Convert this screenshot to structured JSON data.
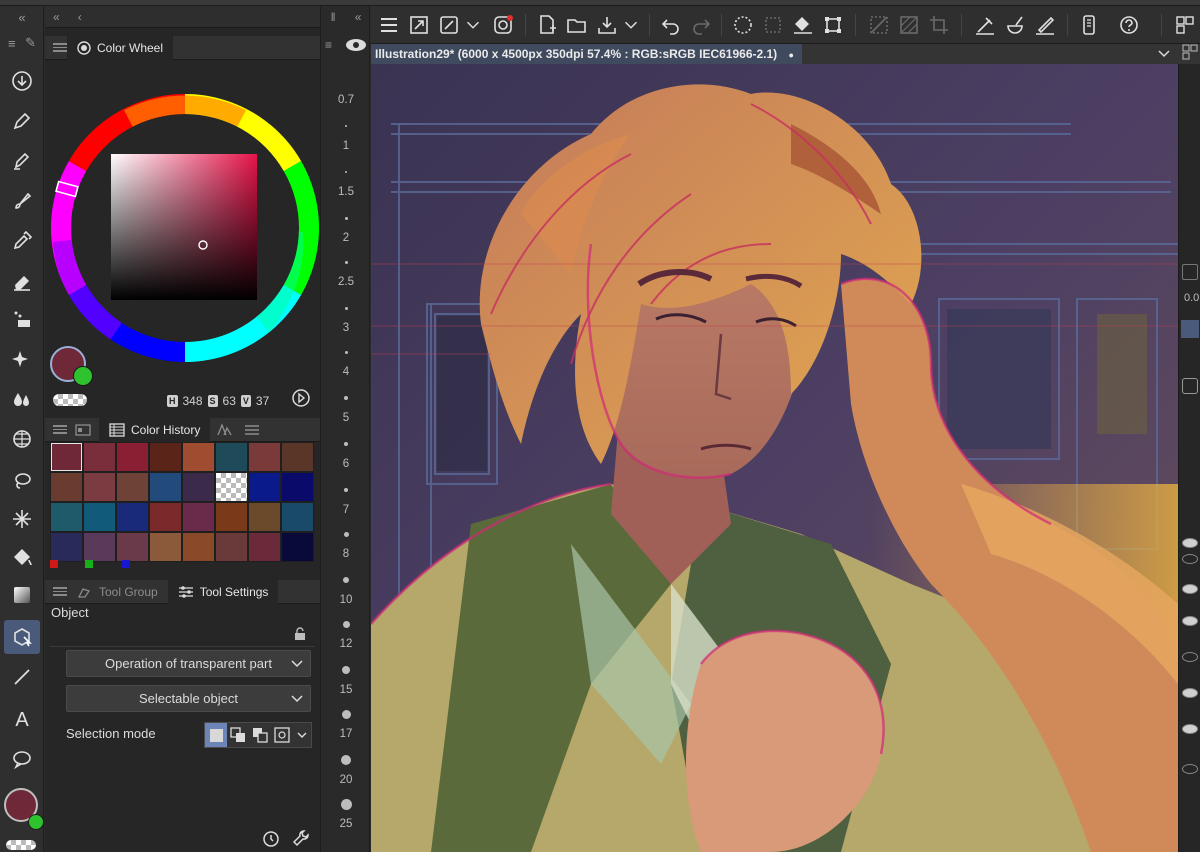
{
  "document": {
    "title": "Illustration29* (6000 x 4500px 350dpi 57.4% : RGB:sRGB IEC61966-2.1)"
  },
  "panels": {
    "color_wheel_tab": "Color Wheel",
    "color_history_tab": "Color History",
    "tool_group_tab": "Tool Group",
    "tool_settings_tab": "Tool Settings"
  },
  "color": {
    "hsv": {
      "h_label": "H",
      "h": "348",
      "s_label": "S",
      "s": "63",
      "v_label": "V",
      "v": "37"
    },
    "main_color": "#6e2838",
    "sub_color": "#2ec32e"
  },
  "color_history": [
    "#6e2838",
    "#7a2d3a",
    "#8a1f33",
    "#5a2418",
    "#a04c30",
    "#1e4a5a",
    "#7a3a3a",
    "#5a3628",
    "#6a3c30",
    "#7a3c40",
    "#6e4236",
    "#224a7a",
    "#3c2a4a",
    "checker",
    "#0a1a8a",
    "#0a0a6a",
    "#1e5a6a",
    "#125a7a",
    "#1a2a7a",
    "#7a2a2a",
    "#6a2a4a",
    "#7a3a1a",
    "#6a4a2a",
    "#1a4a6a",
    "#2a2a5a",
    "#5a3a5a",
    "#6a3a4a",
    "#8a5a3a",
    "#8a4a2a",
    "#6a3a3a",
    "#6a2a3a",
    "#0a0a3a"
  ],
  "history_markers": [
    "#d01818",
    "#18b018",
    "#1818d0"
  ],
  "tool_settings": {
    "section_label": "Object",
    "transparent_dropdown": "Operation of transparent part",
    "selectable_dropdown": "Selectable object",
    "selection_mode_label": "Selection mode"
  },
  "ruler": {
    "labels": [
      "0.7",
      "1",
      "1.5",
      "2",
      "2.5",
      "3",
      "4",
      "5",
      "6",
      "7",
      "8",
      "10",
      "12",
      "15",
      "17",
      "20",
      "25"
    ]
  }
}
